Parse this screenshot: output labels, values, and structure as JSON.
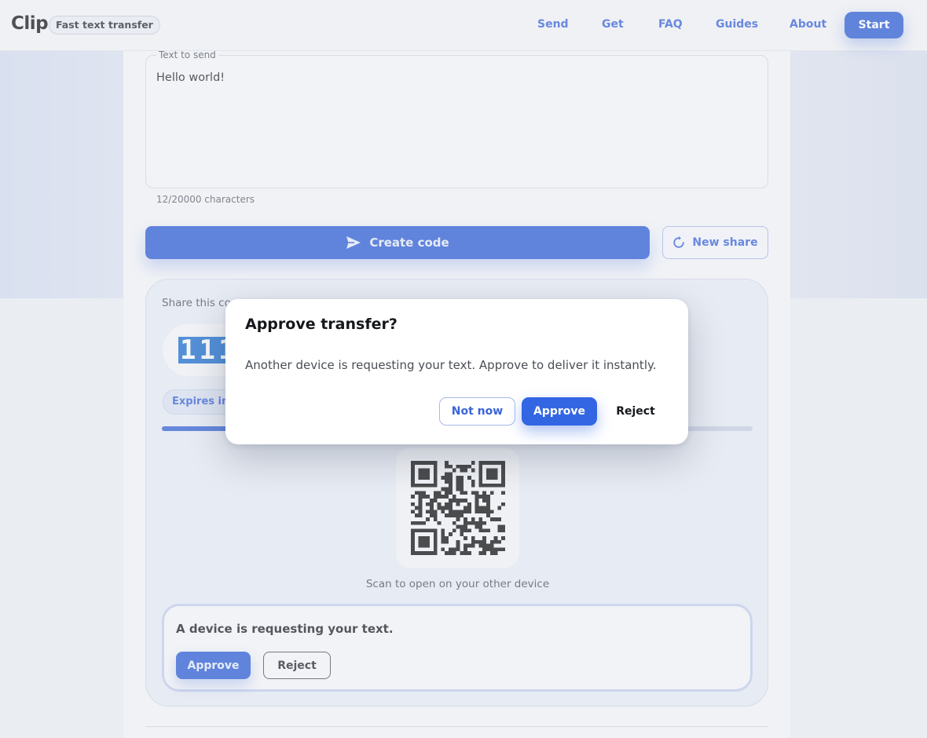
{
  "header": {
    "brand": "Clip",
    "tagline": "Fast text transfer",
    "nav": [
      {
        "label": "Send"
      },
      {
        "label": "Get"
      },
      {
        "label": "FAQ"
      },
      {
        "label": "Guides"
      },
      {
        "label": "About"
      }
    ],
    "start_label": "Start"
  },
  "send_form": {
    "textarea_label": "Text to send",
    "text_value": "Hello world!",
    "char_count": "12/20000 characters",
    "create_label": "Create code",
    "new_share_label": "New share"
  },
  "share": {
    "label": "Share this co",
    "code_visible": "111",
    "expires_visible": "Expires in 0",
    "progress_fraction": 0.3,
    "qr_caption": "Scan to open on your other device",
    "request": {
      "text": "A device is requesting your text.",
      "approve_label": "Approve",
      "reject_label": "Reject"
    }
  },
  "modal": {
    "title": "Approve transfer?",
    "body": "Another device is requesting your text. Approve to deliver it instantly.",
    "not_now_label": "Not now",
    "approve_label": "Approve",
    "reject_label": "Reject"
  },
  "colors": {
    "accent": "#2f5fd6",
    "accent_text": "#3b64d8",
    "modal_approve": "#3266e3"
  },
  "icons": {
    "create": "send-icon",
    "new_share": "refresh-icon",
    "qr": "qr-code-icon"
  }
}
